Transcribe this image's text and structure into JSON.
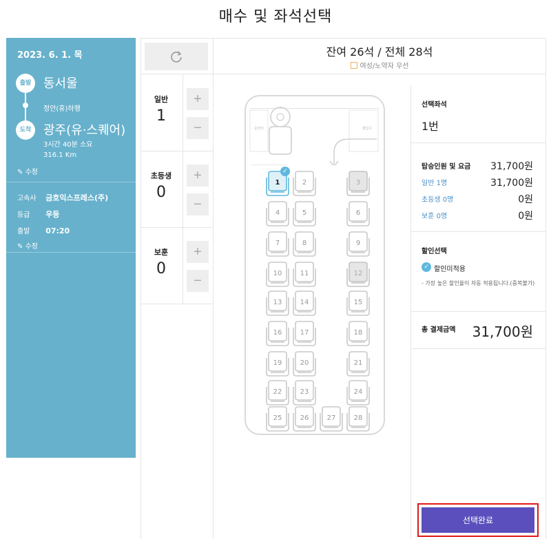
{
  "page": {
    "title": "매수 및 좌석선택"
  },
  "sidebar": {
    "date": "2023. 6. 1. 목",
    "departure_badge": "출발",
    "arrival_badge": "도착",
    "departure": "동서울",
    "via": "정안(휴)하행",
    "arrival": "광주(유·스퀘어)",
    "duration": "3시간 40분 소요",
    "distance": "316.1 Km",
    "edit_label": "수정",
    "company_key": "고속사",
    "company": "금호익스프레스(주)",
    "grade_key": "등급",
    "grade": "우등",
    "depart_key": "출발",
    "depart_time": "07:20"
  },
  "seat_header": {
    "count_text": "잔여 26석 / 전체 28석",
    "legend": "여성/노약자 우선"
  },
  "counters": [
    {
      "label": "일반",
      "value": "1"
    },
    {
      "label": "초등생",
      "value": "0"
    },
    {
      "label": "보훈",
      "value": "0"
    }
  ],
  "bus": {
    "driver_label": "운전석",
    "door_label": "출입구",
    "seats": [
      {
        "num": "1",
        "state": "selected"
      },
      {
        "num": "2",
        "state": "available"
      },
      {
        "num": "3",
        "state": "sold"
      },
      {
        "num": "4",
        "state": "available"
      },
      {
        "num": "5",
        "state": "available"
      },
      {
        "num": "6",
        "state": "available"
      },
      {
        "num": "7",
        "state": "available"
      },
      {
        "num": "8",
        "state": "available"
      },
      {
        "num": "9",
        "state": "available"
      },
      {
        "num": "10",
        "state": "available"
      },
      {
        "num": "11",
        "state": "available"
      },
      {
        "num": "12",
        "state": "sold"
      },
      {
        "num": "13",
        "state": "available"
      },
      {
        "num": "14",
        "state": "available"
      },
      {
        "num": "15",
        "state": "available"
      },
      {
        "num": "16",
        "state": "available"
      },
      {
        "num": "17",
        "state": "available"
      },
      {
        "num": "18",
        "state": "available"
      },
      {
        "num": "19",
        "state": "available"
      },
      {
        "num": "20",
        "state": "available"
      },
      {
        "num": "21",
        "state": "available"
      },
      {
        "num": "22",
        "state": "available"
      },
      {
        "num": "23",
        "state": "available"
      },
      {
        "num": "24",
        "state": "available"
      },
      {
        "num": "25",
        "state": "available"
      },
      {
        "num": "26",
        "state": "available"
      },
      {
        "num": "27",
        "state": "available"
      },
      {
        "num": "28",
        "state": "available"
      }
    ]
  },
  "summary": {
    "selected_seat_title": "선택좌석",
    "selected_seat": "1번",
    "fare_title": "탑승인원 및 요금",
    "fare_total": "31,700원",
    "rows": [
      {
        "label": "일반 1명",
        "value": "31,700원"
      },
      {
        "label": "초등생 0명",
        "value": "0원"
      },
      {
        "label": "보훈 0명",
        "value": "0원"
      }
    ],
    "discount_title": "할인선택",
    "discount_option": "할인미적용",
    "discount_note": "- 가장 높은 할인율이 자동 적용됩니다.(중복불가)",
    "total_title": "총 결제금액",
    "total_value": "31,700원",
    "confirm": "선택완료"
  },
  "colors": {
    "sidebar_bg": "#67b1cc",
    "confirm_bg": "#5a4fbc",
    "highlight_border": "#e01818",
    "selected_seat": "#5fb8dd"
  }
}
